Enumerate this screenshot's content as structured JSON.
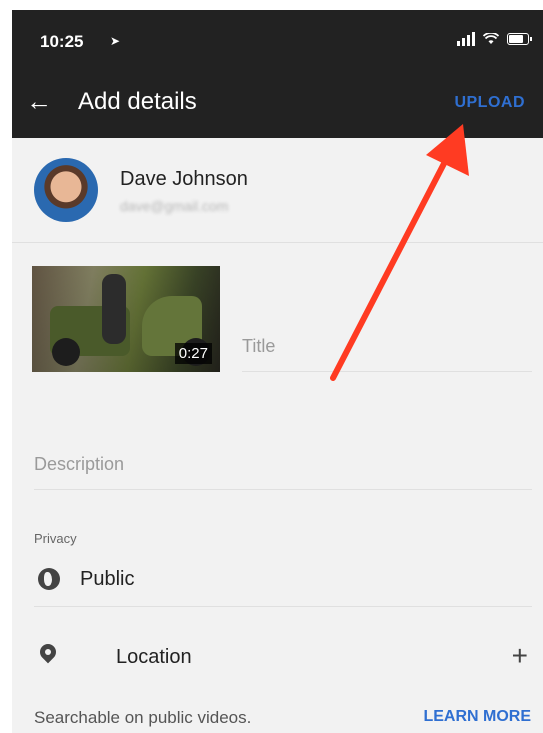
{
  "status_bar": {
    "time": "10:25",
    "location_glyph": "➤"
  },
  "header": {
    "back_glyph": "←",
    "title": "Add details",
    "upload_label": "UPLOAD"
  },
  "account": {
    "name": "Dave Johnson",
    "email": "dave@gmail.com"
  },
  "video": {
    "duration": "0:27",
    "title_placeholder": "Title"
  },
  "description": {
    "placeholder": "Description"
  },
  "privacy": {
    "label": "Privacy",
    "value": "Public"
  },
  "location": {
    "label": "Location",
    "add_glyph": "+"
  },
  "footer": {
    "note": "Searchable on public videos.",
    "learn_more": "LEARN MORE"
  },
  "colors": {
    "header_bg": "#222222",
    "accent": "#2f6fd1",
    "annotation_arrow": "#ff3b22"
  }
}
